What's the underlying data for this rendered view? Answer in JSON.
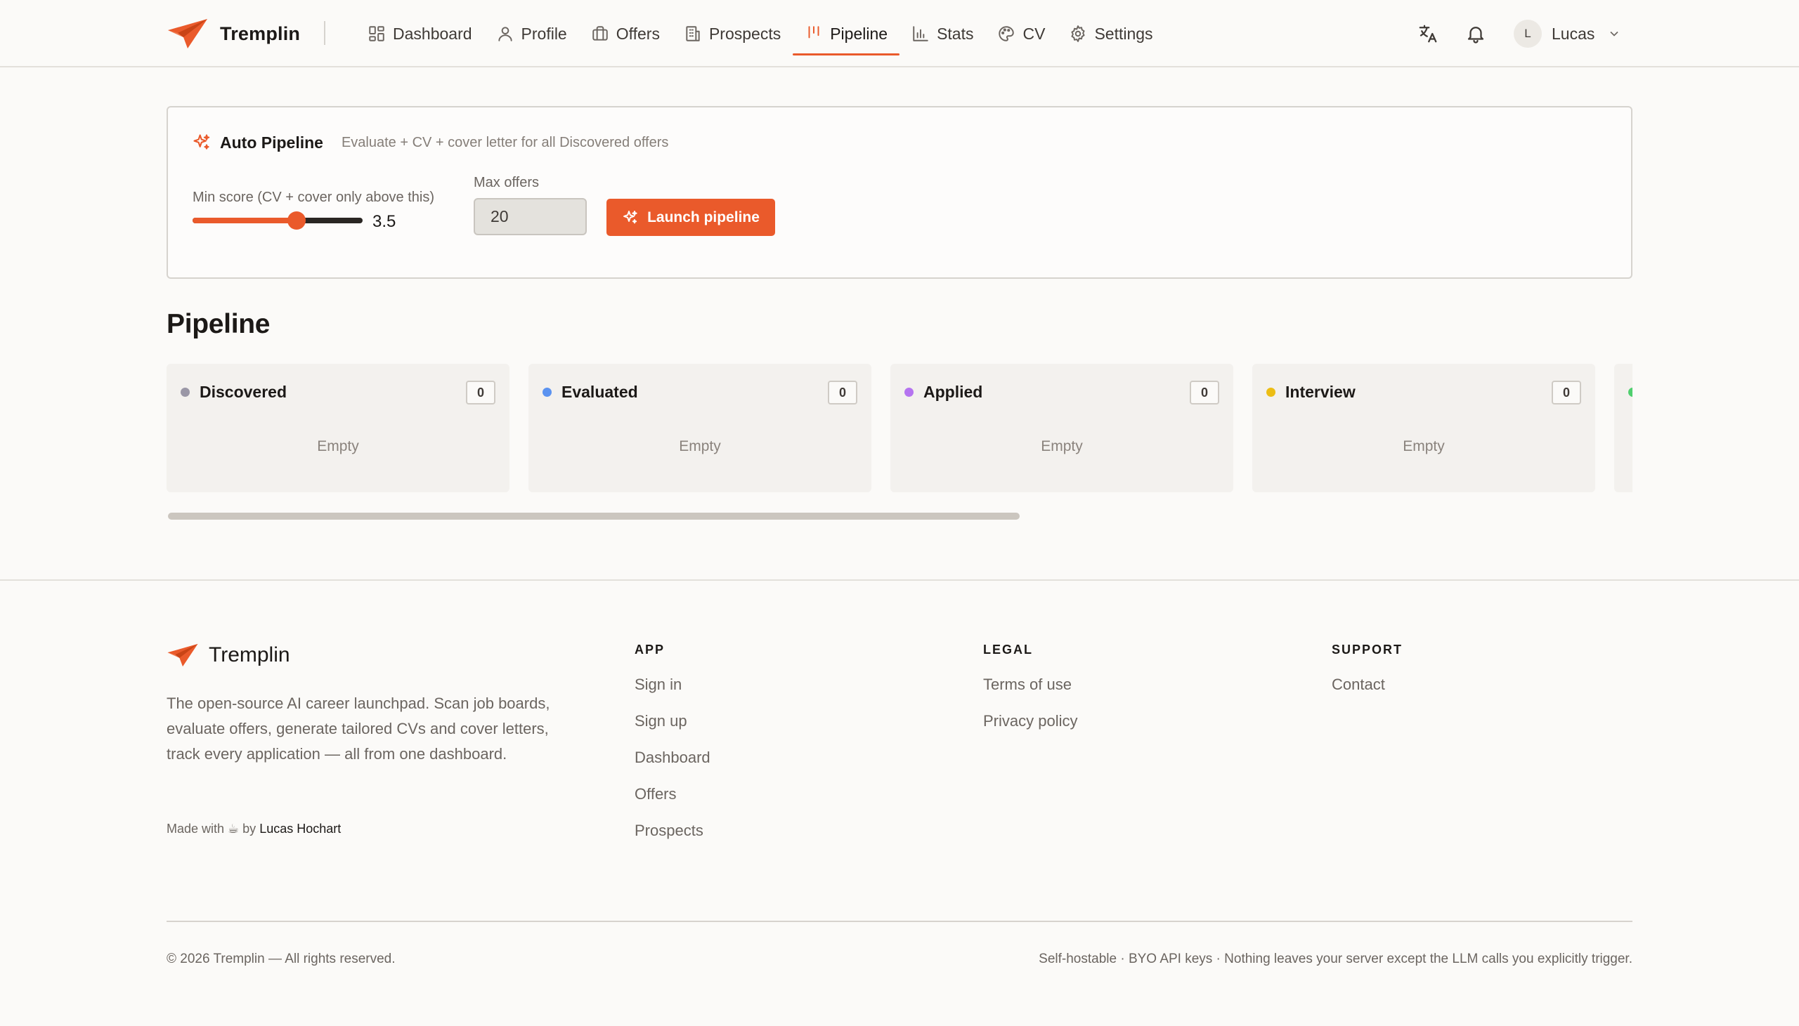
{
  "nav": {
    "brand": "Tremplin",
    "links": [
      {
        "label": "Dashboard",
        "icon": "dashboard-icon"
      },
      {
        "label": "Profile",
        "icon": "user-icon"
      },
      {
        "label": "Offers",
        "icon": "briefcase-icon"
      },
      {
        "label": "Prospects",
        "icon": "building-icon"
      },
      {
        "label": "Pipeline",
        "icon": "kanban-icon",
        "active": true
      },
      {
        "label": "Stats",
        "icon": "bar-chart-icon"
      },
      {
        "label": "CV",
        "icon": "palette-icon"
      },
      {
        "label": "Settings",
        "icon": "gear-icon"
      }
    ],
    "user": {
      "initial": "L",
      "name": "Lucas"
    }
  },
  "auto_pipeline": {
    "title": "Auto Pipeline",
    "subtitle": "Evaluate + CV + cover letter for all Discovered offers",
    "min_score_label": "Min score (CV + cover only above this)",
    "min_score_value": "3.5",
    "min_score_fraction": 0.61,
    "max_offers_label": "Max offers",
    "max_offers_value": "20",
    "launch_label": "Launch pipeline"
  },
  "pipeline": {
    "title": "Pipeline",
    "columns": [
      {
        "name": "Discovered",
        "count": "0",
        "empty": "Empty",
        "color": "#9a97a6"
      },
      {
        "name": "Evaluated",
        "count": "0",
        "empty": "Empty",
        "color": "#5b93f0"
      },
      {
        "name": "Applied",
        "count": "0",
        "empty": "Empty",
        "color": "#b574f0"
      },
      {
        "name": "Interview",
        "count": "0",
        "empty": "Empty",
        "color": "#ecbd14"
      },
      {
        "name": "",
        "count": "",
        "empty": "",
        "color": "#4fcf6e"
      }
    ]
  },
  "footer": {
    "brand": "Tremplin",
    "description": "The open-source AI career launchpad. Scan job boards, evaluate offers, generate tailored CVs and cover letters, track every application — all from one dashboard.",
    "made_prefix": "Made with ☕ by",
    "made_author": "Lucas Hochart",
    "columns": [
      {
        "title": "APP",
        "links": [
          "Sign in",
          "Sign up",
          "Dashboard",
          "Offers",
          "Prospects"
        ]
      },
      {
        "title": "LEGAL",
        "links": [
          "Terms of use",
          "Privacy policy"
        ]
      },
      {
        "title": "SUPPORT",
        "links": [
          "Contact"
        ]
      }
    ],
    "copyright": "© 2026 Tremplin — All rights reserved.",
    "note": "Self-hostable · BYO API keys · Nothing leaves your server except the LLM calls you explicitly trigger."
  },
  "colors": {
    "accent": "#ea5a2b"
  }
}
